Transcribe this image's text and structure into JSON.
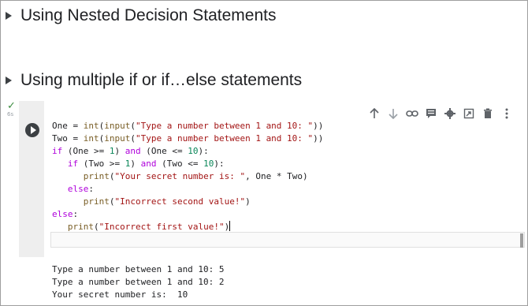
{
  "sections": [
    {
      "title": "Using Nested Decision Statements"
    },
    {
      "title": "Using multiple if or if…else statements"
    }
  ],
  "cell": {
    "status_time": "6s",
    "toolbar_icons": [
      "arrow-up-icon",
      "arrow-down-icon",
      "link-icon",
      "comment-icon",
      "gear-icon",
      "mirror-cell-icon",
      "delete-icon",
      "more-vert-icon"
    ],
    "code_lines": [
      "One = int(input(\"Type a number between 1 and 10: \"))",
      "Two = int(input(\"Type a number between 1 and 10: \"))",
      "if (One >= 1) and (One <= 10):",
      "   if (Two >= 1) and (Two <= 10):",
      "      print(\"Your secret number is: \", One * Two)",
      "   else:",
      "      print(\"Incorrect second value!\")",
      "else:",
      "   print(\"Incorrect first value!\")"
    ],
    "output_lines": [
      "Type a number between 1 and 10: 5",
      "Type a number between 1 and 10: 2",
      "Your secret number is:  10"
    ]
  },
  "colors": {
    "keyword": "#af00db",
    "builtin": "#795e26",
    "string": "#a31515",
    "number": "#098658",
    "gutter": "#eeeeee",
    "success": "#3c8d40"
  }
}
